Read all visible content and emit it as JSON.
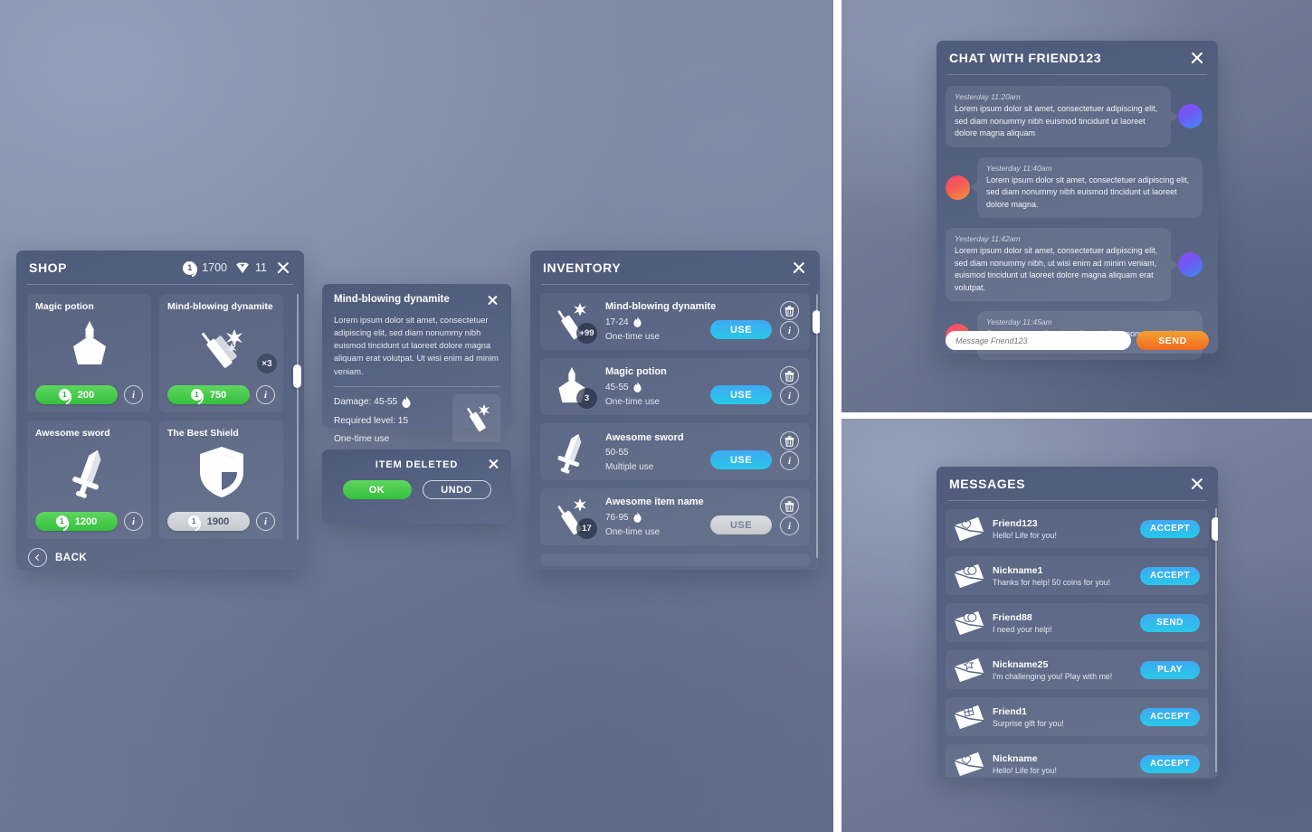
{
  "shop": {
    "title": "SHOP",
    "coins": "1700",
    "gems": "11",
    "back_label": "BACK",
    "items": [
      {
        "name": "Magic potion",
        "price": "200",
        "icon": "potion-icon",
        "qty": "",
        "affordable": true
      },
      {
        "name": "Mind-blowing dynamite",
        "price": "750",
        "icon": "dynamite-icon",
        "qty": "×3",
        "affordable": true
      },
      {
        "name": "Awesome sword",
        "price": "1200",
        "icon": "sword-icon",
        "qty": "",
        "affordable": true
      },
      {
        "name": "The Best Shield",
        "price": "1900",
        "icon": "shield-icon",
        "qty": "",
        "affordable": false
      }
    ]
  },
  "detail": {
    "title": "Mind-blowing dynamite",
    "description": "Lorem ipsum dolor sit amet, consectetuer adipiscing elit, sed diam nonummy nibh euismod tincidunt ut laoreet dolore magna aliquam erat volutpat. Ut wisi enim ad minim veniam.",
    "damage": "Damage: 45-55",
    "required_level": "Required level: 15",
    "use_type": "One-time use",
    "thumb_icon": "dynamite-icon"
  },
  "deleted_dialog": {
    "title": "ITEM DELETED",
    "ok_label": "OK",
    "undo_label": "UNDO"
  },
  "inventory": {
    "title": "INVENTORY",
    "rows": [
      {
        "name": "Mind-blowing dynamite",
        "damage": "17-24",
        "has_flame": true,
        "use_type": "One-time use",
        "qty": "+99",
        "icon": "dynamite-icon",
        "action": "USE",
        "enabled": true
      },
      {
        "name": "Magic potion",
        "damage": "45-55",
        "has_flame": true,
        "use_type": "One-time use",
        "qty": "3",
        "icon": "potion-icon",
        "action": "USE",
        "enabled": true
      },
      {
        "name": "Awesome sword",
        "damage": "50-55",
        "has_flame": false,
        "use_type": "Multiple use",
        "qty": "",
        "icon": "sword-icon",
        "action": "USE",
        "enabled": true
      },
      {
        "name": "Awesome item name",
        "damage": "76-95",
        "has_flame": true,
        "use_type": "One-time use",
        "qty": "17",
        "icon": "dynamite-icon",
        "action": "USE",
        "enabled": false
      }
    ]
  },
  "chat": {
    "title": "CHAT WITH FRIEND123",
    "input_placeholder": "Message Friend123",
    "send_label": "SEND",
    "messages": [
      {
        "time": "Yesterday 11:20am",
        "text": "Lorem ipsum dolor sit amet, consectetuer adipiscing elit, sed diam nonummy nibh euismod tincidunt ut laoreet dolore magna aliquam",
        "side": "left",
        "avatar": "purple"
      },
      {
        "time": "Yesterday 11:40am",
        "text": "Lorem ipsum dolor sit amet, consectetuer adipiscing elit, sed diam nonummy nibh euismod tincidunt ut laoreet dolore magna.",
        "side": "right",
        "avatar": "orange"
      },
      {
        "time": "Yesterday 11:42am",
        "text": "Lorem ipsum dolor sit amet, consectetuer adipiscing elit, sed diam nonummy nibh, ut wisi enim ad minim veniam, euismod tincidunt ut laoreet dolore magna aliquam erat volutpat.",
        "side": "left",
        "avatar": "purple"
      },
      {
        "time": "Yesterday 11:45am",
        "text": "Consectetuer adipiscing elit, sed diam nonummy nibh euismod.",
        "side": "right",
        "avatar": "orange"
      }
    ]
  },
  "messages_panel": {
    "title": "MESSAGES",
    "rows": [
      {
        "name": "Friend123",
        "text": "Hello! Life for you!",
        "action": "ACCEPT",
        "icon": "envelope-heart-icon"
      },
      {
        "name": "Nickname1",
        "text": "Thanks for help! 50 coins for you!",
        "action": "ACCEPT",
        "icon": "envelope-coin-icon"
      },
      {
        "name": "Friend88",
        "text": "I need your help!",
        "action": "SEND",
        "icon": "envelope-coin-icon"
      },
      {
        "name": "Nickname25",
        "text": "I'm challenging you! Play with me!",
        "action": "PLAY",
        "icon": "envelope-star-icon"
      },
      {
        "name": "Friend1",
        "text": "Surprise gift for you!",
        "action": "ACCEPT",
        "icon": "envelope-gift-icon"
      },
      {
        "name": "Nickname",
        "text": "Hello! Life for you!",
        "action": "ACCEPT",
        "icon": "envelope-heart-icon"
      }
    ]
  },
  "colors": {
    "green": "#3ec648",
    "blue": "#3fa9f5",
    "cyan": "#28c8e8",
    "orange": "#ef6a21",
    "panel": "#4f5f80",
    "background": "#7c87a5"
  }
}
